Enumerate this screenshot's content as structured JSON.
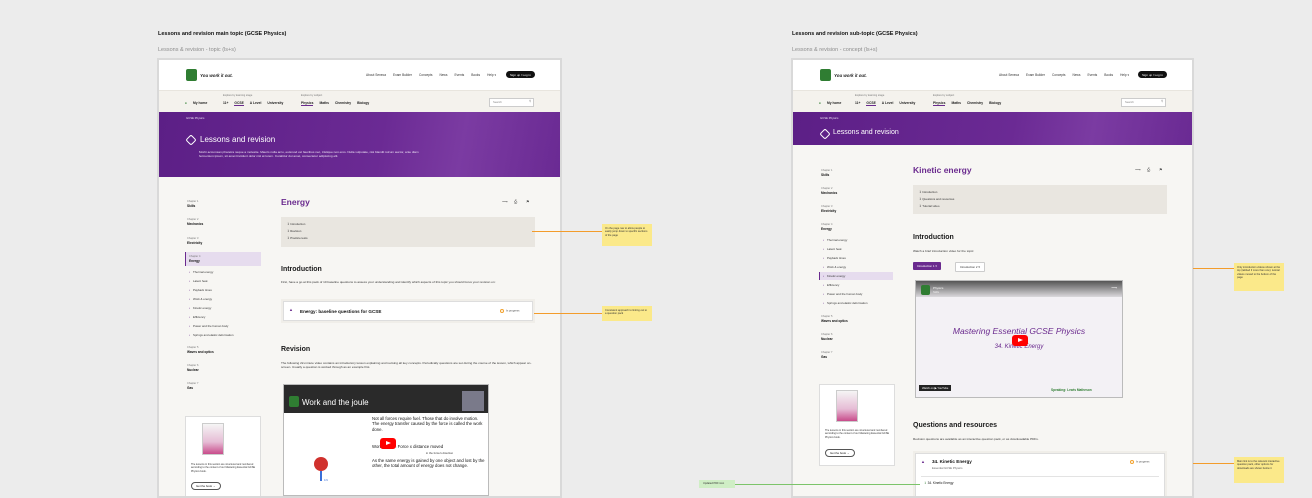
{
  "captions": {
    "left_title": "Lessons and revision main topic (GCSE Physics)",
    "left_sub": "Lessons & revision - topic (ls+s)",
    "right_title": "Lessons and revision sub-topic (GCSE Physics)",
    "right_sub": "Lessons & revision - concept (ls+s)"
  },
  "brand": {
    "logo": "SAVE",
    "tagline": "You work it out.",
    "accent": "#6a2a8e",
    "logo_color": "#2f7d32"
  },
  "topnav": [
    "About Seneca",
    "Exam Builder",
    "Concepts",
    "News",
    "Events",
    "Books",
    "Help ▾"
  ],
  "signin": "Sign up / Log in",
  "subbar": {
    "stage_label": "Explore by learning stage",
    "home": "My home",
    "stages": [
      "11+",
      "11+",
      "GCSE",
      "A Level",
      "University"
    ],
    "subject_label": "Explore by subject",
    "subjects": [
      "Physics",
      "Maths",
      "Chemistry",
      "Biology"
    ],
    "search_placeholder": "Search"
  },
  "left": {
    "crumb": "GCSE Physics",
    "banner_title": "Lessons and revision",
    "banner_desc": "Morbi accumsan pharetra neque a molestie. Mauris nulla arcu, euismod vel faucibus nec, tristique non eros. Nulla vulputate, nisi blandit rutrum auctor, ante diam fermentum ipsum, sit amet tincidunt dolor nisl at lorem. Curabitur dui amet, consectetur adipiscing elit.",
    "chapters": [
      {
        "ch": "Chapter 1",
        "name": "Skills"
      },
      {
        "ch": "Chapter 2",
        "name": "Mechanics"
      },
      {
        "ch": "Chapter 3",
        "name": "Electricity"
      },
      {
        "ch": "Chapter 4",
        "name": "Energy"
      },
      {
        "ch": "Chapter 5",
        "name": "Waves and optics"
      },
      {
        "ch": "Chapter 6",
        "name": "Nuclear"
      },
      {
        "ch": "Chapter 7",
        "name": "Gas"
      }
    ],
    "subitems": [
      "Thermal energy",
      "Latent heat",
      "Payback times",
      "Work & energy",
      "Kinetic energy",
      "Efficiency",
      "Power and the human body",
      "Springs and elastic deformation"
    ],
    "heading": "Energy",
    "toc": [
      "Introduction",
      "Revision",
      "Practice tests"
    ],
    "intro_heading": "Introduction",
    "intro_text": "First, have a go at this pack of 10 baseline questions to assess your understanding and identify which aspects of this topic you should focus your revision on:",
    "card_title": "Energy: baseline questions for GCSE",
    "card_progress": "In progress",
    "revision_heading": "Revision",
    "revision_text": "The following 22-minute video contains an introductory lesson explaining and revising all key concepts. Periodically questions are set during the course of the lesson, which appear on-screen. Usually a question is worked through as an example first.",
    "video": {
      "title": "Work and the joule",
      "line1": "Not all forces require fuel.  Those that do involve motion.  The energy transfer caused by the force is called the work done.",
      "formula": "Work done = Force x distance moved",
      "formula_note": "in the force's direction",
      "line2": "As the same energy is gained by one object and lost by the other, the total amount of energy does not change.",
      "unit": "1N"
    },
    "book_text": "The lessons in this section are structured and numbered according to the content of our Mastering Essential GCSE Physics book.",
    "book_btn": "Get the book →",
    "notes": [
      "On the page nav to allow people to easily jump down to specific sections of the page",
      "Consistent approach to linking out to a question pack"
    ]
  },
  "right": {
    "chapters": [
      {
        "ch": "Chapter 1",
        "name": "Skills"
      },
      {
        "ch": "Chapter 2",
        "name": "Mechanics"
      },
      {
        "ch": "Chapter 3",
        "name": "Electricity"
      },
      {
        "ch": "Chapter 4",
        "name": "Energy"
      },
      {
        "ch": "Chapter 5",
        "name": "Waves and optics"
      },
      {
        "ch": "Chapter 6",
        "name": "Nuclear"
      },
      {
        "ch": "Chapter 7",
        "name": "Gas"
      }
    ],
    "subitems": [
      "Thermal energy",
      "Latent heat",
      "Payback times",
      "Work & energy",
      "Kinetic energy",
      "Efficiency",
      "Power and the human body",
      "Springs and elastic deformation"
    ],
    "heading": "Kinetic energy",
    "toc": [
      "Introduction",
      "Questions and resources",
      "Tutorial video"
    ],
    "intro_heading": "Introduction",
    "intro_text": "Watch a brief introduction video for the topic:",
    "tab1": "Introduction 1 ▾",
    "tab2": "Introduction 2 ▾",
    "video": {
      "channel": "Physics",
      "channel_sub": "Skills",
      "title": "Mastering Essential GCSE Physics",
      "subtitle": "34. Kinetic Energy",
      "watch": "Watch on ▶ YouTube",
      "speaker": "Speaking: Lewis Matheson"
    },
    "book_text": "The lessons in this section are structured and numbered according to the content of our Mastering Essential GCSE Physics book.",
    "book_btn": "Get the book →",
    "qr_heading": "Questions and resources",
    "qr_text": "Revision questions are available as an interactive question pack, or as downloadable PDFs.",
    "card_title": "34. Kinetic Energy",
    "card_sub": "Essential GCSE Physics",
    "card_progress": "In progress",
    "card_item": "34. Kinetic Energy",
    "notes": [
      "Only introduction videos shown at the top (tabbed if more than one); tutorial videos moved to the bottom of the page",
      "Main link is to the relevant interactive question pack, other options for downloads are shown below it"
    ],
    "green_note": "Updated PDF icon"
  }
}
